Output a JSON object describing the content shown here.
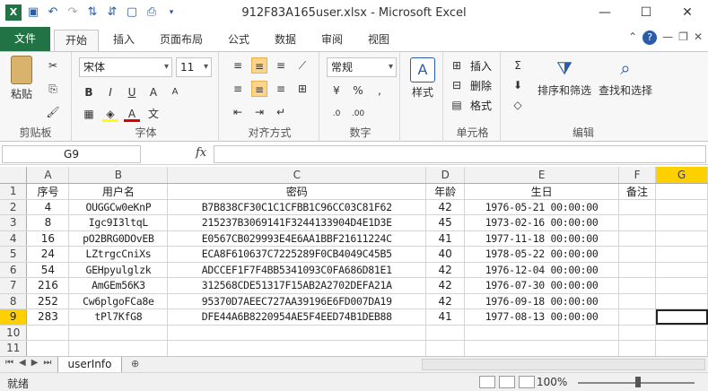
{
  "window": {
    "title": "912F83A165user.xlsx - Microsoft Excel"
  },
  "tabs": [
    "文件",
    "开始",
    "插入",
    "页面布局",
    "公式",
    "数据",
    "审阅",
    "视图"
  ],
  "ribbon": {
    "clipboard": {
      "paste": "粘贴",
      "label": "剪贴板"
    },
    "font": {
      "name": "宋体",
      "size": "11",
      "label": "字体"
    },
    "align": {
      "label": "对齐方式"
    },
    "number": {
      "format": "常规",
      "label": "数字"
    },
    "styles": {
      "btn": "样式"
    },
    "cells": {
      "insert": "插入",
      "delete": "删除",
      "format": "格式",
      "label": "单元格"
    },
    "editing": {
      "sort": "排序和筛选",
      "find": "查找和选择",
      "label": "编辑"
    }
  },
  "formula_bar": {
    "name_box": "G9",
    "fx": "fx",
    "content": ""
  },
  "sheet": {
    "columns": [
      "A",
      "B",
      "C",
      "D",
      "E",
      "F",
      "G"
    ],
    "header_row": [
      "序号",
      "用户名",
      "密码",
      "年龄",
      "生日",
      "备注"
    ],
    "rows": [
      [
        "4",
        "OUGGCw0eKnP",
        "B7B838CF30C1C1CFBB1C96CC03C81F62",
        "42",
        "1976-05-21  00:00:00",
        ""
      ],
      [
        "8",
        "Igc9I3ltqL",
        "215237B3069141F3244133904D4E1D3E",
        "45",
        "1973-02-16  00:00:00",
        ""
      ],
      [
        "16",
        "pO2BRG0DOvEB",
        "E0567CB029993E4E6AA1BBF21611224C",
        "41",
        "1977-11-18  00:00:00",
        ""
      ],
      [
        "24",
        "LZtrgcCniXs",
        "ECA8F610637C7225289F0CB4049C45B5",
        "40",
        "1978-05-22  00:00:00",
        ""
      ],
      [
        "54",
        "GEHpyulglzk",
        "ADCCEF1F7F4BB5341093C0FA686D81E1",
        "42",
        "1976-12-04  00:00:00",
        ""
      ],
      [
        "216",
        "AmGEm56K3",
        "312568CDE51317F15AB2A2702DEFA21A",
        "42",
        "1976-07-30  00:00:00",
        ""
      ],
      [
        "252",
        "Cw6plgoFCa8e",
        "95370D7AEEC727AA39196E6FD007DA19",
        "42",
        "1976-09-18  00:00:00",
        ""
      ],
      [
        "283",
        "tPl7KfG8",
        "DFE44A6B8220954AE5F4EED74B1DEB88",
        "41",
        "1977-08-13  00:00:00",
        ""
      ]
    ],
    "row_numbers": [
      "1",
      "2",
      "3",
      "4",
      "5",
      "6",
      "7",
      "8",
      "9",
      "10",
      "11"
    ],
    "tab_name": "userInfo"
  },
  "status": {
    "ready": "就绪",
    "zoom": "100%"
  },
  "colors": {
    "accent": "#217346",
    "selection": "#ffd000"
  }
}
